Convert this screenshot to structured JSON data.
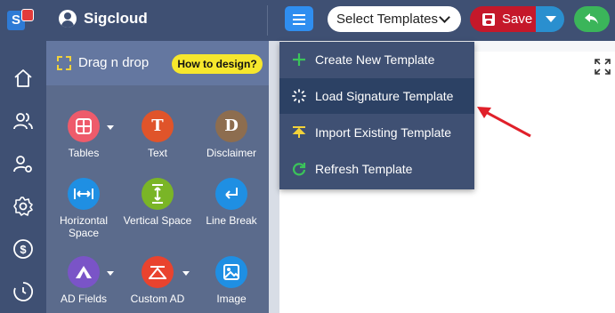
{
  "app": {
    "brand": "Sigcloud",
    "logo_letter": "S"
  },
  "toolbar": {
    "select_templates": "Select Templates",
    "save_label": "Save"
  },
  "panel": {
    "title": "Drag n drop",
    "how_to": "How to design?",
    "tools": [
      {
        "label": "Tables",
        "icon": "table-icon",
        "color": "#ee5b6b",
        "glyph": ""
      },
      {
        "label": "Text",
        "icon": "text-icon",
        "color": "#e0542a",
        "glyph": "T"
      },
      {
        "label": "Disclaimer",
        "icon": "disclaimer-icon",
        "color": "#8d6d4f",
        "glyph": "D"
      },
      {
        "label": "Horizontal Space",
        "icon": "horizontal-space-icon",
        "color": "#1f8fe3",
        "glyph": ""
      },
      {
        "label": "Vertical Space",
        "icon": "vertical-space-icon",
        "color": "#7ab526",
        "glyph": ""
      },
      {
        "label": "Line Break",
        "icon": "line-break-icon",
        "color": "#1f8fe3",
        "glyph": ""
      },
      {
        "label": "AD Fields",
        "icon": "ad-fields-icon",
        "color": "#7a54c7",
        "glyph": ""
      },
      {
        "label": "Custom AD",
        "icon": "custom-ad-icon",
        "color": "#e9432e",
        "glyph": ""
      },
      {
        "label": "Image",
        "icon": "image-icon",
        "color": "#1f8fe3",
        "glyph": ""
      }
    ]
  },
  "dropdown": {
    "items": [
      {
        "label": "Create New Template",
        "icon": "plus-icon"
      },
      {
        "label": "Load Signature Template",
        "icon": "loading-icon",
        "active": true
      },
      {
        "label": "Import Existing Template",
        "icon": "import-icon"
      },
      {
        "label": "Refresh Template",
        "icon": "refresh-icon"
      }
    ]
  },
  "rail": [
    "home-icon",
    "users-icon",
    "user-settings-icon",
    "settings-icon",
    "billing-icon",
    "history-icon"
  ],
  "colors": {
    "accent": "#2f8ef0",
    "save": "#c5182a",
    "undo": "#3bb55a",
    "arrow": "#e0202a"
  }
}
